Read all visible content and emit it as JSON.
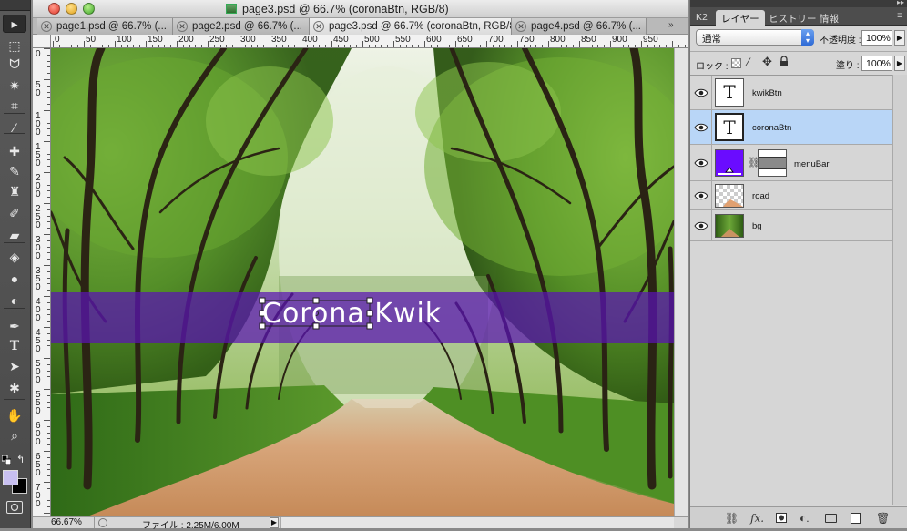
{
  "window": {
    "title": "page3.psd @ 66.7% (coronaBtn, RGB/8)"
  },
  "tabs": [
    {
      "label": "page1.psd @ 66.7% (...",
      "active": false
    },
    {
      "label": "page2.psd @ 66.7% (...",
      "active": false
    },
    {
      "label": "page3.psd @ 66.7% (coronaBtn, RGB/8)",
      "active": true
    },
    {
      "label": "page4.psd @ 66.7% (...",
      "active": false
    }
  ],
  "ruler": {
    "h_labels": [
      "0",
      "50",
      "100",
      "150",
      "200",
      "250",
      "300",
      "350",
      "400",
      "450",
      "500",
      "550",
      "600",
      "650",
      "700",
      "750",
      "800",
      "850",
      "900",
      "950"
    ],
    "v_labels": [
      "0",
      "50",
      "100",
      "150",
      "200",
      "250",
      "300",
      "350",
      "400",
      "450",
      "500",
      "550",
      "600",
      "650",
      "700"
    ]
  },
  "canvas": {
    "banner_text": "Corona Kwik",
    "banner_color": "#5a14b4"
  },
  "status": {
    "zoom": "66.67%",
    "file_info": "ファイル : 2.25M/6.00M"
  },
  "tools": [
    {
      "name": "move-tool-icon",
      "glyph": "▸"
    },
    {
      "name": "marquee-tool-icon",
      "glyph": "⬚"
    },
    {
      "name": "lasso-tool-icon",
      "glyph": "ᗢ"
    },
    {
      "name": "magic-wand-tool-icon",
      "glyph": "✷"
    },
    {
      "name": "crop-tool-icon",
      "glyph": "⌗"
    },
    {
      "name": "eyedropper-tool-icon",
      "glyph": "⁄"
    },
    {
      "name": "healing-brush-tool-icon",
      "glyph": "✚"
    },
    {
      "name": "brush-tool-icon",
      "glyph": "✎"
    },
    {
      "name": "stamp-tool-icon",
      "glyph": "♜"
    },
    {
      "name": "history-brush-tool-icon",
      "glyph": "✐"
    },
    {
      "name": "eraser-tool-icon",
      "glyph": "▰"
    },
    {
      "name": "paint-bucket-tool-icon",
      "glyph": "◈"
    },
    {
      "name": "blur-tool-icon",
      "glyph": "●"
    },
    {
      "name": "dodge-tool-icon",
      "glyph": "◐"
    },
    {
      "name": "pen-tool-icon",
      "glyph": "✒"
    },
    {
      "name": "type-tool-icon",
      "glyph": "T"
    },
    {
      "name": "path-selection-tool-icon",
      "glyph": "➤"
    },
    {
      "name": "shape-tool-icon",
      "glyph": "✱"
    },
    {
      "name": "hand-tool-icon",
      "glyph": "✋"
    },
    {
      "name": "zoom-tool-icon",
      "glyph": "⌕"
    }
  ],
  "colors": {
    "foreground": "#c8c0f0",
    "background": "#000000"
  },
  "panel": {
    "tabs": [
      "K2",
      "レイヤー",
      "ヒストリー",
      "情報"
    ],
    "blend_mode": "通常",
    "opacity_label": "不透明度 :",
    "opacity_value": "100%",
    "lock_label": "ロック :",
    "fill_label": "塗り :",
    "fill_value": "100%",
    "layers": [
      {
        "name": "kwikBtn",
        "type": "text",
        "selected": false
      },
      {
        "name": "coronaBtn",
        "type": "text",
        "selected": true
      },
      {
        "name": "menuBar",
        "type": "shape",
        "selected": false
      },
      {
        "name": "road",
        "type": "image",
        "selected": false
      },
      {
        "name": "bg",
        "type": "image",
        "selected": false
      }
    ]
  }
}
